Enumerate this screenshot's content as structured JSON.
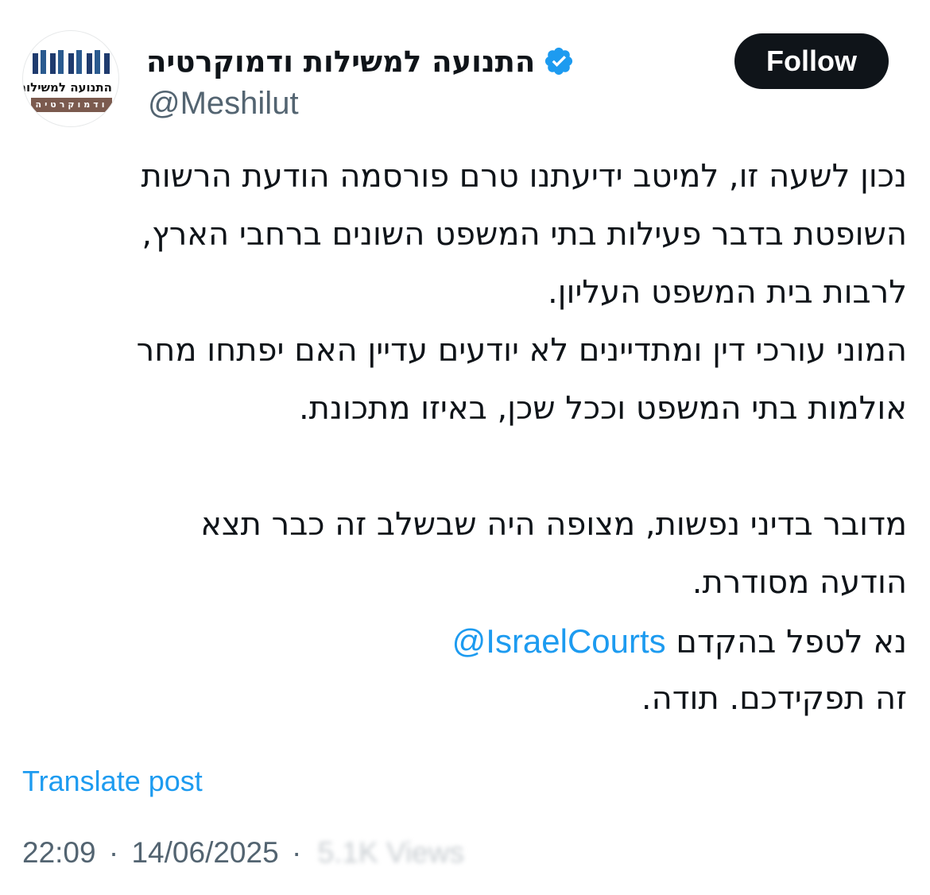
{
  "header": {
    "avatar": {
      "org_name": "התנועה למשילות",
      "org_sub": "ודמוקרטיה"
    },
    "display_name": "התנועה למשילות ודמוקרטיה",
    "handle": "@Meshilut",
    "verified_icon": "verified-badge-icon",
    "follow_label": "Follow"
  },
  "tweet": {
    "lines": [
      "נכון לשעה זו, למיטב ידיעתנו טרם פורסמה הודעת הרשות",
      "השופטת בדבר פעילות בתי המשפט השונים ברחבי הארץ,",
      "לרבות בית המשפט העליון.",
      "המוני עורכי דין ומתדיינים לא יודעים עדיין האם יפתחו מחר",
      "אולמות בתי המשפט וככל שכן, באיזו מתכונת."
    ],
    "lines2": [
      "מדובר בדיני נפשות, מצופה היה שבשלב זה כבר תצא",
      "הודעה מסודרת."
    ],
    "mention_prefix": "נא לטפל בהקדם",
    "mention": "@IsraelCourts",
    "closing": "זה תפקידכם. תודה."
  },
  "footer": {
    "translate_label": "Translate post",
    "time": "22:09",
    "separator": "·",
    "date": "14/06/2025",
    "views": "5.1K Views"
  },
  "colors": {
    "accent": "#1d9bf0",
    "text": "#0f1419",
    "muted": "#536471",
    "follow_bg": "#0f1419"
  }
}
